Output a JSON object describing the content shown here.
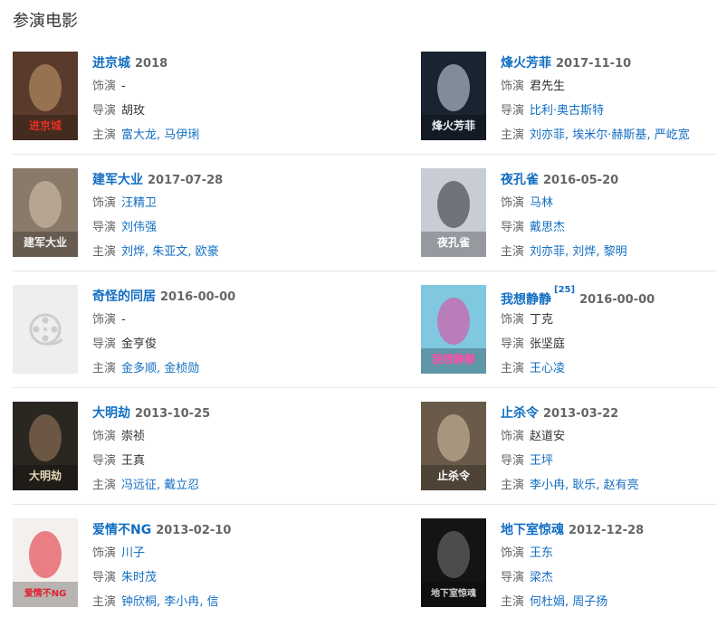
{
  "section_title": "参演电影",
  "labels": {
    "role": "饰演",
    "director": "导演",
    "stars": "主演"
  },
  "films": [
    {
      "title": "进京城",
      "date": "2018",
      "ref": "",
      "role": "-",
      "role_link": false,
      "director": [
        "胡玫"
      ],
      "director_link": false,
      "stars": [
        "富大龙",
        "马伊琍"
      ],
      "poster": {
        "bg": "#5a3a2a",
        "accent": "#c8a070",
        "text": "进京城",
        "text_color": "#e03020",
        "icon": ""
      }
    },
    {
      "title": "烽火芳菲",
      "date": "2017-11-10",
      "ref": "",
      "role": "君先生",
      "role_link": false,
      "director": [
        "比利·奥古斯特"
      ],
      "director_link": true,
      "stars": [
        "刘亦菲",
        "埃米尔·赫斯基",
        "严屹宽"
      ],
      "poster": {
        "bg": "#1a2330",
        "accent": "#d8e4f0",
        "text": "烽火芳菲",
        "text_color": "#e8eef4",
        "icon": ""
      }
    },
    {
      "title": "建军大业",
      "date": "2017-07-28",
      "ref": "",
      "role": "汪精卫",
      "role_link": true,
      "director": [
        "刘伟强"
      ],
      "director_link": true,
      "stars": [
        "刘烨",
        "朱亚文",
        "欧豪"
      ],
      "poster": {
        "bg": "#8a7a6a",
        "accent": "#d8c8b0",
        "text": "建军大业",
        "text_color": "#f0f0f0",
        "icon": ""
      }
    },
    {
      "title": "夜孔雀",
      "date": "2016-05-20",
      "ref": "",
      "role": "马林",
      "role_link": true,
      "director": [
        "戴思杰"
      ],
      "director_link": true,
      "stars": [
        "刘亦菲",
        "刘烨",
        "黎明"
      ],
      "poster": {
        "bg": "#c8ccd4",
        "accent": "#2a2a30",
        "text": "夜孔雀",
        "text_color": "#ffffff",
        "icon": ""
      }
    },
    {
      "title": "奇怪的同居",
      "date": "2016-00-00",
      "ref": "",
      "role": "-",
      "role_link": false,
      "director": [
        "金亨俊"
      ],
      "director_link": false,
      "stars": [
        "金多顺",
        "金桢勋"
      ],
      "poster": {
        "bg": "#eeeeee",
        "accent": "#cccccc",
        "text": "",
        "text_color": "#cccccc",
        "icon": "film-reel-icon"
      }
    },
    {
      "title": "我想静静",
      "date": "2016-00-00",
      "ref": "[25]",
      "role": "丁克",
      "role_link": false,
      "director": [
        "张坚庭"
      ],
      "director_link": false,
      "stars": [
        "王心凌"
      ],
      "poster": {
        "bg": "#7fc8e0",
        "accent": "#e8409a",
        "text": "我想静静",
        "text_color": "#ff4fa8",
        "icon": ""
      }
    },
    {
      "title": "大明劫",
      "date": "2013-10-25",
      "ref": "",
      "role": "崇祯",
      "role_link": false,
      "director": [
        "王真"
      ],
      "director_link": false,
      "stars": [
        "冯远征",
        "戴立忍"
      ],
      "poster": {
        "bg": "#2a2620",
        "accent": "#a08060",
        "text": "大明劫",
        "text_color": "#e8d8b8",
        "icon": ""
      }
    },
    {
      "title": "止杀令",
      "date": "2013-03-22",
      "ref": "",
      "role": "赵道安",
      "role_link": false,
      "director": [
        "王坪"
      ],
      "director_link": true,
      "stars": [
        "李小冉",
        "耿乐",
        "赵有亮"
      ],
      "poster": {
        "bg": "#6a5a4a",
        "accent": "#d8c8a8",
        "text": "止杀令",
        "text_color": "#ffffff",
        "icon": ""
      }
    },
    {
      "title": "爱情不NG",
      "date": "2013-02-10",
      "ref": "",
      "role": "川子",
      "role_link": true,
      "director": [
        "朱时茂"
      ],
      "director_link": true,
      "stars": [
        "钟欣桐",
        "李小冉",
        "信"
      ],
      "poster": {
        "bg": "#f4f0ee",
        "accent": "#e02030",
        "text": "爱情不NG",
        "text_color": "#e02030",
        "icon": ""
      }
    },
    {
      "title": "地下室惊魂",
      "date": "2012-12-28",
      "ref": "",
      "role": "王东",
      "role_link": true,
      "director": [
        "梁杰"
      ],
      "director_link": true,
      "stars": [
        "何杜娟",
        "周子扬"
      ],
      "poster": {
        "bg": "#141414",
        "accent": "#7a7a7a",
        "text": "地下室惊魂",
        "text_color": "#d0d0d0",
        "icon": ""
      }
    }
  ]
}
